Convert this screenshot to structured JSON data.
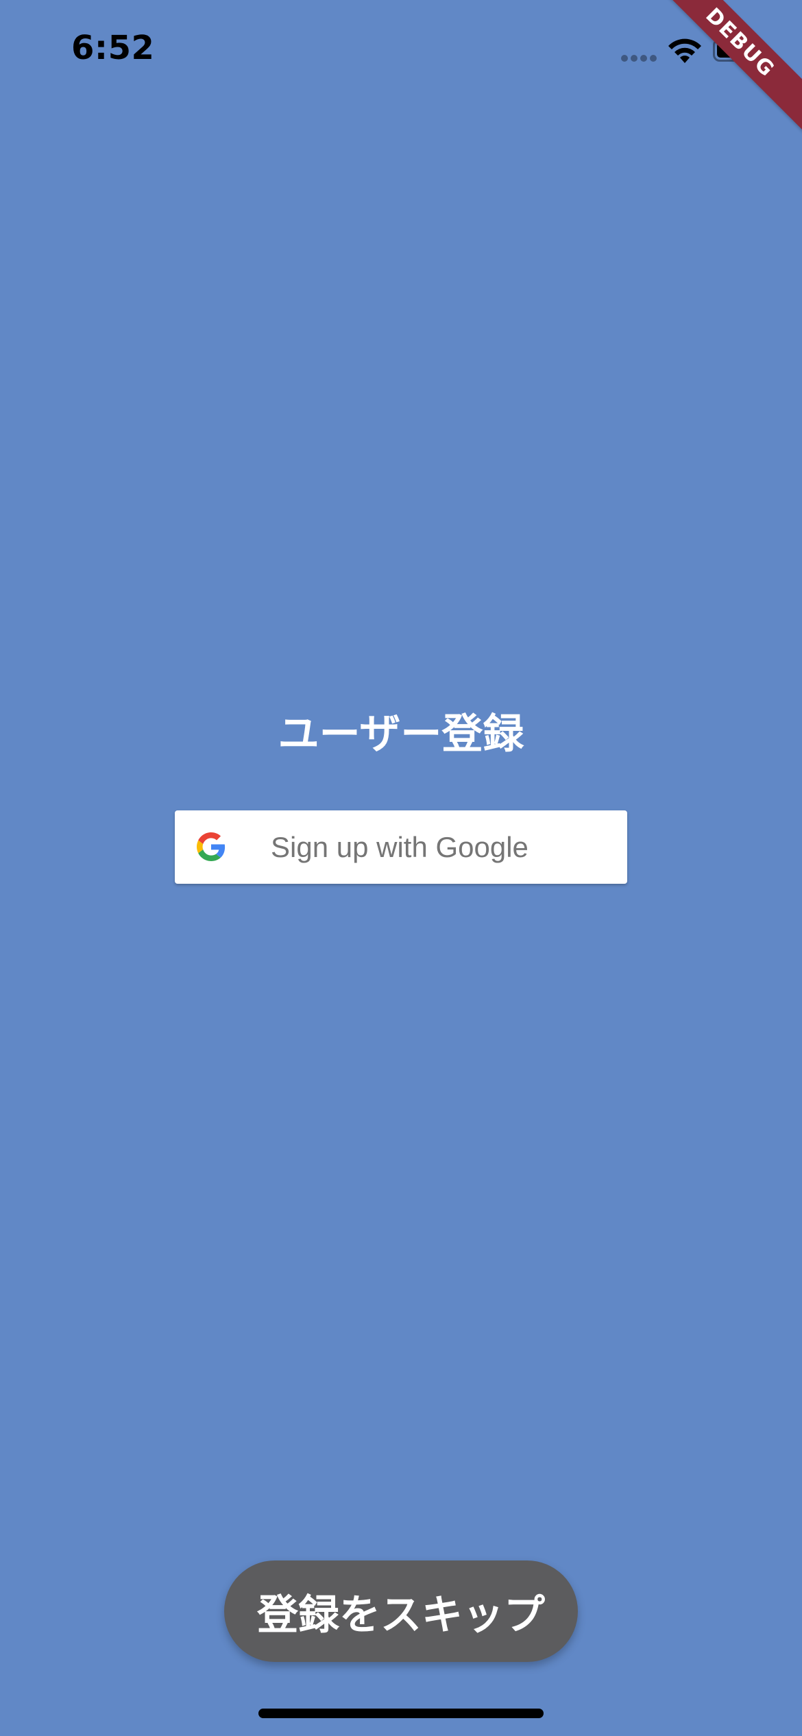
{
  "status_bar": {
    "time": "6:52",
    "wifi_icon": "wifi-icon",
    "battery_icon": "battery-icon",
    "signal_icon": "cellular-signal-icon"
  },
  "debug_banner": {
    "label": "DEBUG",
    "color": "#8b2a3a"
  },
  "main": {
    "title": "ユーザー登録",
    "google_button": {
      "label": "Sign up with Google",
      "icon": "google-logo-icon"
    }
  },
  "footer": {
    "skip_button_label": "登録をスキップ"
  },
  "colors": {
    "background": "#6188c6",
    "skip_button": "#5c5c5e",
    "google_button": "#ffffff",
    "google_text": "#757575"
  }
}
